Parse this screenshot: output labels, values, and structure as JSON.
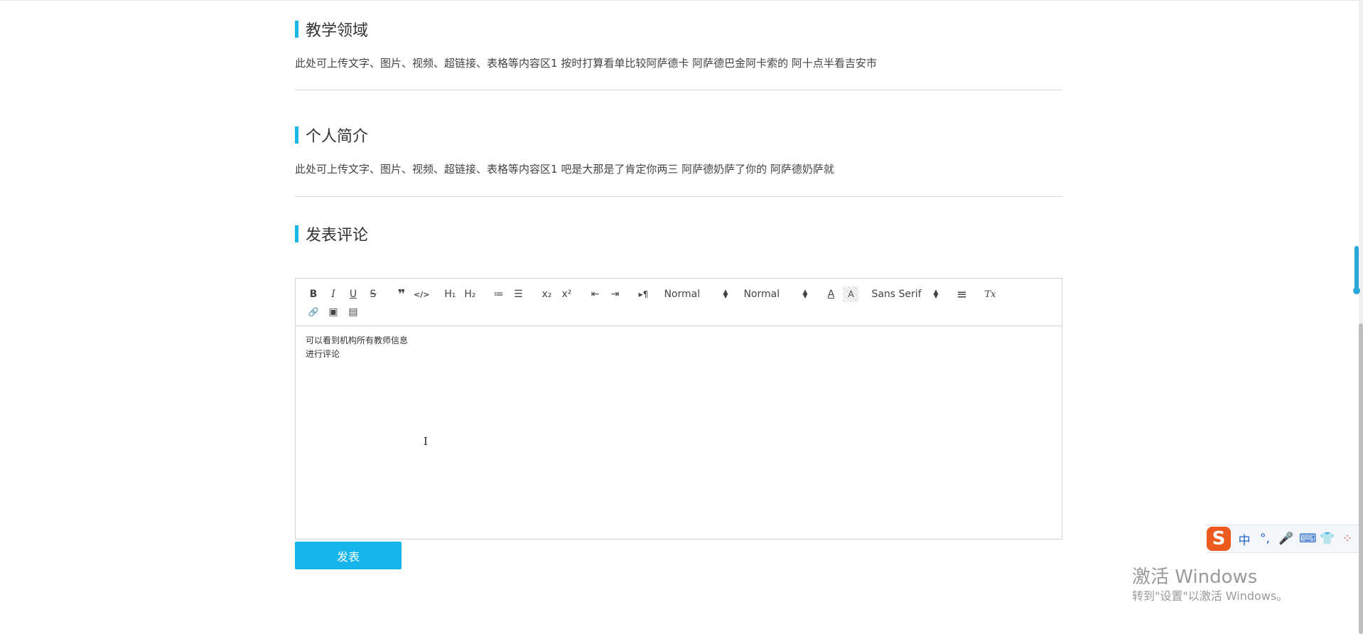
{
  "sections": [
    {
      "title": "教学领域",
      "body": "此处可上传文字、图片、视频、超链接、表格等内容区1 按时打算看单比较阿萨德卡 阿萨德巴金阿卡索的 阿十点半看吉安市"
    },
    {
      "title": "个人简介",
      "body": "此处可上传文字、图片、视频、超链接、表格等内容区1 吧是大那是了肯定你两三 阿萨德奶萨了你的 阿萨德奶萨就"
    },
    {
      "title": "发表评论"
    }
  ],
  "editor": {
    "toolbar": {
      "bold": "B",
      "italic": "I",
      "underline": "U",
      "strike": "S",
      "blockquote": "❞",
      "code": "</>",
      "h1": "H₁",
      "h2": "H₂",
      "ordered_list": "≔",
      "bullet_list": "☰",
      "subscript": "x₂",
      "superscript": "x²",
      "outdent": "⇤",
      "indent": "⇥",
      "direction": "▸¶",
      "size_select": "Normal",
      "header_select": "Normal",
      "font_color": "A",
      "background_color": "A",
      "font_select": "Sans Serif",
      "align": "≡",
      "clean": "Tx",
      "link": "🔗",
      "image": "▣",
      "video": "▤"
    },
    "content_lines": [
      "可以看到机构所有教师信息",
      "进行评论"
    ]
  },
  "submit_label": "发表",
  "ime": {
    "logo": "S",
    "mode": "中",
    "punct": "°,",
    "voice": "🎤",
    "keyboard": "⌨",
    "skin": "👕",
    "tools": "⁘"
  },
  "watermark": {
    "title": "激活 Windows",
    "subtitle": "转到\"设置\"以激活 Windows。"
  },
  "colors": {
    "accent": "#1cb5e6",
    "button": "#16b5ea",
    "ime_logo": "#ec5a1d"
  }
}
